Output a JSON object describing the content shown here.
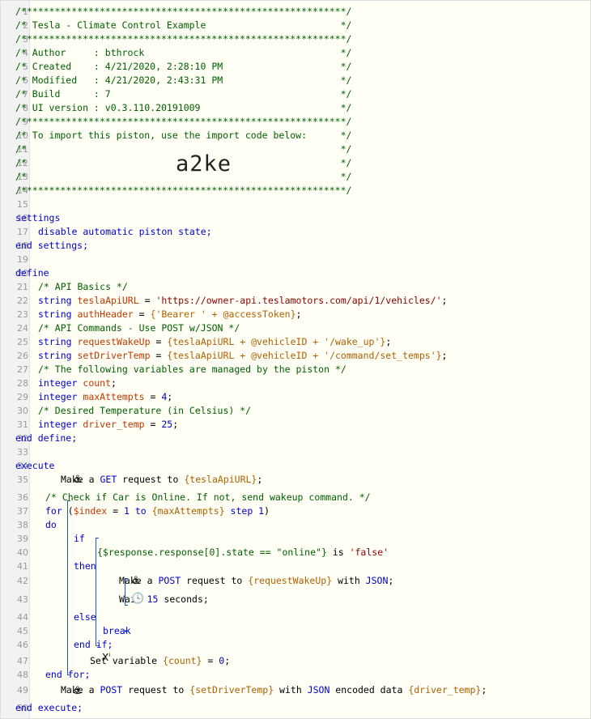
{
  "header_lines": [
    "/**********************************************************/",
    "/* Tesla - Climate Control Example                        */",
    "/**********************************************************/",
    "/* Author     : bthrock                                   */",
    "/* Created    : 4/21/2020, 2:28:10 PM                     */",
    "/* Modified   : 4/21/2020, 2:43:31 PM                     */",
    "/* Build      : 7                                         */",
    "/* UI version : v0.3.110.20191009                         */",
    "/**********************************************************/",
    "/* To import this piston, use the import code below:      */",
    "/*                                                        */",
    "/*                                                        */",
    "/*                                                        */",
    "/**********************************************************/"
  ],
  "import_code": "a2ke",
  "line_numbers": [
    "1",
    "2",
    "3",
    "4",
    "5",
    "6",
    "7",
    "8",
    "9",
    "10",
    "11",
    "12",
    "13",
    "14",
    "15",
    "16",
    "17",
    "18",
    "19",
    "20",
    "21",
    "22",
    "23",
    "24",
    "25",
    "26",
    "27",
    "28",
    "29",
    "30",
    "31",
    "32",
    "33",
    "34",
    "35",
    "36",
    "37",
    "38",
    "39",
    "40",
    "41",
    "42",
    "43",
    "44",
    "45",
    "46",
    "47",
    "48",
    "49",
    "50"
  ],
  "settings": {
    "open": "settings",
    "stmt": "disable automatic piston state;",
    "close": "end settings;"
  },
  "define": {
    "open": "define",
    "comment1": "/* API Basics */",
    "v1_type": "string",
    "v1_name": "teslaApiURL",
    "v1_eq": " = ",
    "v1_val": "'https://owner-api.teslamotors.com/api/1/vehicles/'",
    "v1_end": ";",
    "v2_type": "string",
    "v2_name": "authHeader",
    "v2_eq": " = ",
    "v2_val": "{'Bearer ' + @accessToken}",
    "v2_end": ";",
    "comment2": "/* API Commands - Use POST w/JSON */",
    "v3_type": "string",
    "v3_name": "requestWakeUp",
    "v3_eq": " = ",
    "v3_val": "{teslaApiURL + @vehicleID + '/wake_up'}",
    "v3_end": ";",
    "v4_type": "string",
    "v4_name": "setDriverTemp",
    "v4_eq": " = ",
    "v4_val": "{teslaApiURL + @vehicleID + '/command/set_temps'}",
    "v4_end": ";",
    "comment3": "/* The following variables are managed by the piston */",
    "v5_type": "integer",
    "v5_name": "count",
    "v5_end": ";",
    "v6_type": "integer",
    "v6_name": "maxAttempts",
    "v6_eq": " = ",
    "v6_val": "4",
    "v6_end": ";",
    "comment4": "/* Desired Temperature (in Celsius) */",
    "v7_type": "integer",
    "v7_name": "driver_temp",
    "v7_eq": " = ",
    "v7_val": "25",
    "v7_end": ";",
    "close": "end define;"
  },
  "execute": {
    "open": "execute",
    "l35a": "Make a ",
    "l35b": "GET",
    "l35c": " request to ",
    "l35d": "{teslaApiURL}",
    "l35e": ";",
    "l36": "/* Check if Car is Online. If not, send wakeup command. */",
    "l37a": "for",
    "l37b": " (",
    "l37c": "$index",
    "l37d": " = ",
    "l37e": "1",
    "l37f": " to ",
    "l37g": "{maxAttempts}",
    "l37h": " step ",
    "l37i": "1",
    "l37j": ")",
    "l38": "do",
    "l39": "if",
    "l40a": "{$response.response[0].state == \"online\"}",
    "l40b": " is ",
    "l40c": "'false'",
    "l41": "then",
    "l42a": "Make a ",
    "l42b": "POST",
    "l42c": " request to ",
    "l42d": "{requestWakeUp}",
    "l42e": " with ",
    "l42f": "JSON",
    "l42g": ";",
    "l43a": "Wait ",
    "l43b": "15",
    "l43c": " seconds;",
    "l44": "else",
    "l45": "break",
    "l46": "end if;",
    "l47a": "Set variable ",
    "l47b": "{count}",
    "l47c": " = ",
    "l47d": "0",
    "l47e": ";",
    "l48": "end for;",
    "l49a": "Make a ",
    "l49b": "POST",
    "l49c": " request to ",
    "l49d": "{setDriverTemp}",
    "l49e": " with ",
    "l49f": "JSON",
    "l49g": " encoded data ",
    "l49h": "{driver_temp}",
    "l49i": ";",
    "close": "end execute;"
  },
  "icons": {
    "anchor": "anchor-icon",
    "clock": "clock-icon",
    "setvar": "set-variable-icon"
  }
}
